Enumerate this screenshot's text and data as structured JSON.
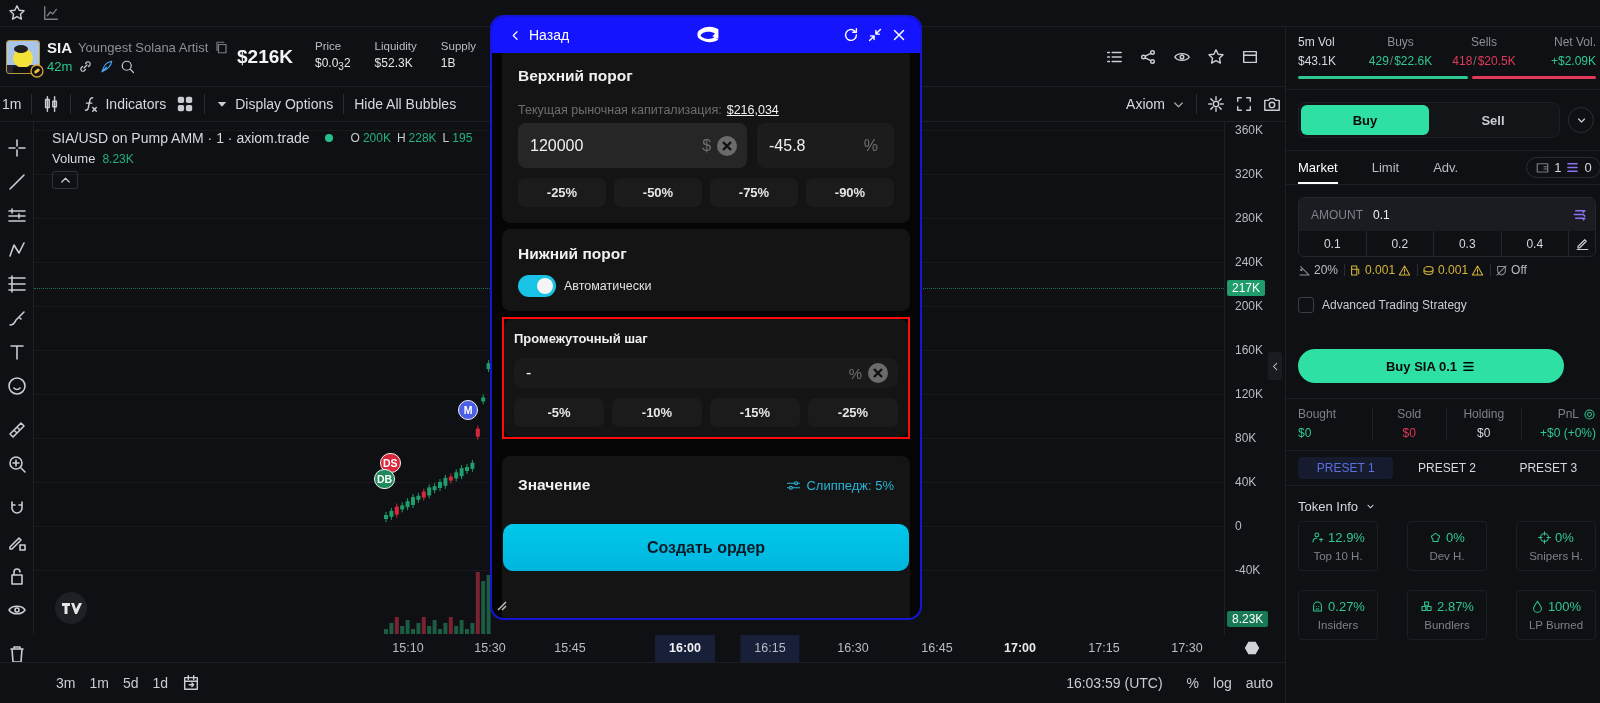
{
  "token": {
    "symbol": "SIA",
    "name": "Youngest Solana Artist",
    "age": "42m",
    "market_cap": "$216K",
    "stats": [
      {
        "label": "Price",
        "value": "$0.0$_{3}$2"
      },
      {
        "label": "Liquidity",
        "value": "$52.3K"
      },
      {
        "label": "Supply",
        "value": "1B"
      }
    ]
  },
  "toolbar": {
    "interval": "1m",
    "indicators": "Indicators",
    "display_options": "Display Options",
    "hide_bubbles": "Hide All Bubbles",
    "source": "Axiom"
  },
  "chart": {
    "legend": {
      "title": "SIA/USD on Pump AMM · 1 · axiom.trade",
      "ohlc": [
        {
          "key": "O",
          "value": "200K"
        },
        {
          "key": "H",
          "value": "228K"
        },
        {
          "key": "L",
          "value": "195"
        }
      ],
      "volume_label": "Volume",
      "volume": "8.23K"
    },
    "markers": [
      {
        "label": "M",
        "color": "#4a5ee8"
      },
      {
        "label": "DS",
        "color": "#d9283c"
      },
      {
        "label": "DB",
        "color": "#1e8a5c"
      }
    ],
    "price_ticks": [
      "360K",
      "320K",
      "280K",
      "240K",
      "200K",
      "160K",
      "120K",
      "80K",
      "40K",
      "0",
      "-40K"
    ],
    "price_badges": [
      {
        "label": "217K",
        "kind": "last"
      },
      {
        "label": "8.23K",
        "kind": "volume"
      }
    ],
    "time_ticks": [
      {
        "label": "15:10",
        "kind": "normal"
      },
      {
        "label": "15:30",
        "kind": "normal"
      },
      {
        "label": "15:45",
        "kind": "normal"
      },
      {
        "label": "16:00",
        "kind": "current"
      },
      {
        "label": "16:15",
        "kind": "range"
      },
      {
        "label": "16:30",
        "kind": "normal"
      },
      {
        "label": "16:45",
        "kind": "normal"
      },
      {
        "label": "17:00",
        "kind": "bold"
      },
      {
        "label": "17:15",
        "kind": "normal"
      },
      {
        "label": "17:30",
        "kind": "normal"
      }
    ]
  },
  "bottom_bar": {
    "ranges": [
      "3m",
      "1m",
      "5d",
      "1d"
    ],
    "clock": "16:03:59 (UTC)",
    "options": [
      "%",
      "log",
      "auto"
    ]
  },
  "order_modal": {
    "back": "Назад",
    "upper": {
      "title": "Верхний порог",
      "market_cap_label": "Текущая рыночная капитализация:",
      "market_cap": "$216,034",
      "price_value": "120000",
      "price_unit": "$",
      "percent_value": "-45.8",
      "percent_unit": "%",
      "presets": [
        "-25%",
        "-50%",
        "-75%",
        "-90%"
      ]
    },
    "lower": {
      "title": "Нижний порог",
      "auto_label": "Автоматически",
      "auto_on": true
    },
    "step": {
      "title": "Промежуточный шаг",
      "value": "-",
      "unit": "%",
      "highlighted": true,
      "presets": [
        "-5%",
        "-10%",
        "-15%",
        "-25%"
      ]
    },
    "amount": {
      "title": "Значение",
      "slippage": "Слиппедж: 5%"
    },
    "submit": "Создать ордер"
  },
  "trade_panel": {
    "volume_stats": [
      {
        "label": "5m Vol",
        "value": "$43.1K",
        "kind": "total"
      },
      {
        "label": "Buys",
        "value": "429",
        "separator": "/",
        "amount": "$22.6K",
        "kind": "buy"
      },
      {
        "label": "Sells",
        "value": "418",
        "separator": "/",
        "amount": "$20.5K",
        "kind": "sell"
      },
      {
        "label": "Net Vol.",
        "value": "+$2.09K",
        "kind": "net"
      }
    ],
    "volume_bar": {
      "level": 0.57
    },
    "sides": [
      {
        "label": "Buy",
        "selected": true
      },
      {
        "label": "Sell",
        "selected": false
      }
    ],
    "order_tabs": [
      {
        "label": "Market",
        "selected": true
      },
      {
        "label": "Limit",
        "selected": false
      },
      {
        "label": "Adv.",
        "selected": false
      }
    ],
    "wallets": "1",
    "sol_balance": "0",
    "amount": {
      "label": "AMOUNT",
      "value": "0.1",
      "presets": [
        "0.1",
        "0.2",
        "0.3",
        "0.4"
      ]
    },
    "settings": [
      {
        "value": "20%",
        "kind": "slippage",
        "warning": false
      },
      {
        "value": "0.001",
        "kind": "priority",
        "warning": true
      },
      {
        "value": "0.001",
        "kind": "bribe",
        "warning": true
      },
      {
        "value": "Off",
        "kind": "mev",
        "warning": false
      }
    ],
    "advanced": {
      "label": "Advanced Trading Strategy",
      "checked": false
    },
    "submit": "Buy SIA 0.1",
    "position": [
      {
        "label": "Bought",
        "value": "$0",
        "kind": "buy"
      },
      {
        "label": "Sold",
        "value": "$0",
        "kind": "sell"
      },
      {
        "label": "Holding",
        "value": "$0",
        "kind": "neutral"
      },
      {
        "label": "PnL",
        "value": "+$0 (+0%)",
        "kind": "pnl"
      }
    ],
    "presets": [
      {
        "label": "PRESET 1",
        "selected": true
      },
      {
        "label": "PRESET 2",
        "selected": false
      },
      {
        "label": "PRESET 3",
        "selected": false
      }
    ],
    "token_info": {
      "title": "Token Info",
      "metrics": [
        {
          "value": "12.9%",
          "label": "Top 10 H.",
          "kind": "holders"
        },
        {
          "value": "0%",
          "label": "Dev H.",
          "kind": "dev"
        },
        {
          "value": "0%",
          "label": "Snipers H.",
          "kind": "snipers"
        },
        {
          "value": "0.27%",
          "label": "Insiders",
          "kind": "insiders"
        },
        {
          "value": "2.87%",
          "label": "Bundlers",
          "kind": "bundlers"
        },
        {
          "value": "100%",
          "label": "LP Burned",
          "kind": "burn"
        }
      ]
    }
  }
}
